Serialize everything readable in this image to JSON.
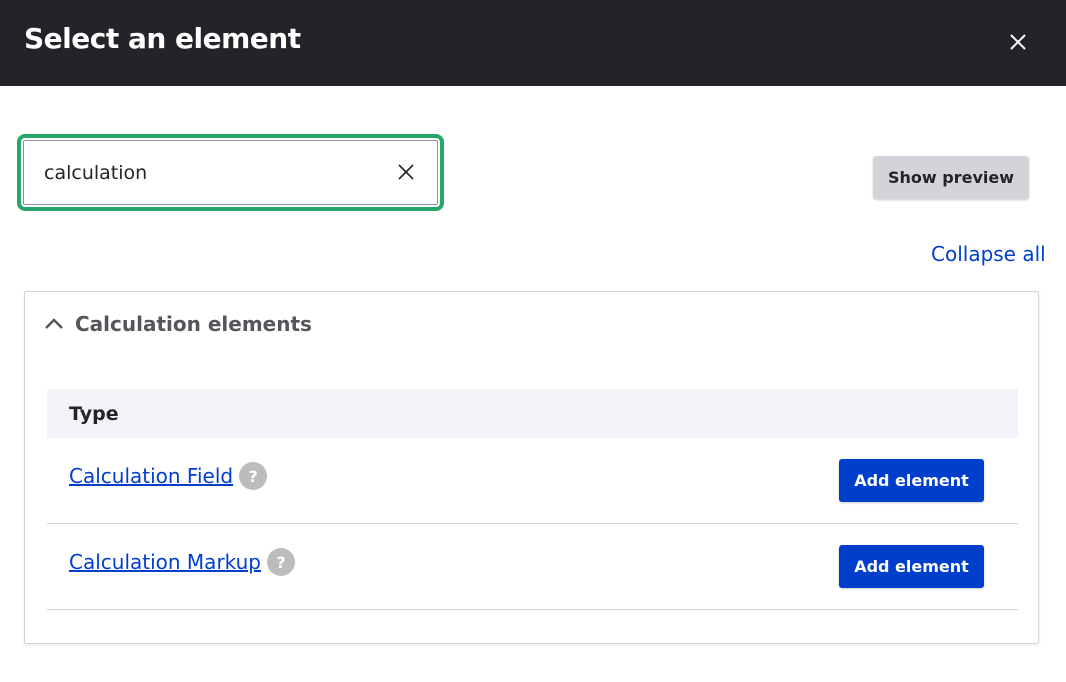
{
  "dialog": {
    "title": "Select an element",
    "close_icon": "close-icon"
  },
  "search": {
    "value": "calculation",
    "clear_icon": "clear-icon"
  },
  "toolbar": {
    "show_preview_label": "Show preview",
    "collapse_all_label": "Collapse all"
  },
  "group": {
    "label": "Calculation elements",
    "expanded": true,
    "table": {
      "header": "Type",
      "rows": [
        {
          "name": "Calculation Field",
          "help": "?",
          "action": "Add element"
        },
        {
          "name": "Calculation Markup",
          "help": "?",
          "action": "Add element"
        }
      ]
    }
  },
  "colors": {
    "header_bg": "#232429",
    "focus_ring": "#26a769",
    "primary": "#003ecc",
    "secondary_button": "#d3d4d9",
    "table_header_bg": "#f3f4f9"
  }
}
